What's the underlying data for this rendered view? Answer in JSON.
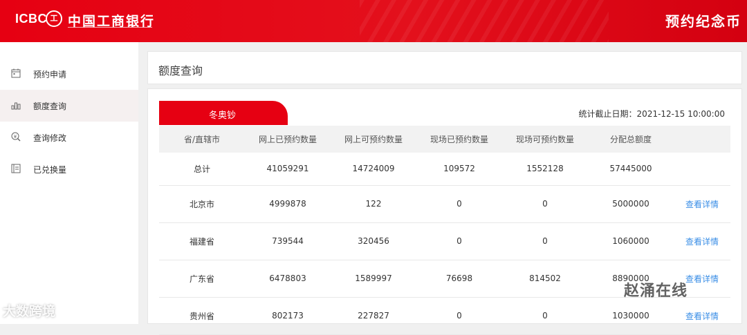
{
  "header": {
    "logo_text": "ICBC",
    "logo_mark": "工",
    "bank_name": "中国工商银行",
    "section_title": "预约纪念币",
    "brand_color": "#e60012"
  },
  "sidebar": {
    "items": [
      {
        "label": "预约申请",
        "icon": "calendar-icon"
      },
      {
        "label": "额度查询",
        "icon": "bar-chart-icon"
      },
      {
        "label": "查询修改",
        "icon": "coin-search-icon"
      },
      {
        "label": "已兑换量",
        "icon": "ledger-icon"
      }
    ]
  },
  "page_title": "额度查询",
  "tab": {
    "label": "冬奥钞"
  },
  "stat_date": "统计截止日期：2021-12-15 10:00:00",
  "table": {
    "headers": [
      "省/直辖市",
      "网上已预约数量",
      "网上可预约数量",
      "现场已预约数量",
      "现场可预约数量",
      "分配总额度",
      ""
    ],
    "rows": [
      [
        "总计",
        "41059291",
        "14724009",
        "109572",
        "1552128",
        "57445000",
        ""
      ],
      [
        "北京市",
        "4999878",
        "122",
        "0",
        "0",
        "5000000",
        "查看详情"
      ],
      [
        "福建省",
        "739544",
        "320456",
        "0",
        "0",
        "1060000",
        "查看详情"
      ],
      [
        "广东省",
        "6478803",
        "1589997",
        "76698",
        "814502",
        "8890000",
        "查看详情"
      ],
      [
        "贵州省",
        "802173",
        "227827",
        "0",
        "0",
        "1030000",
        "查看详情"
      ]
    ],
    "link_color": "#3a8ee6"
  },
  "watermarks": {
    "left": "大数跨境",
    "right": "赵涌在线"
  }
}
